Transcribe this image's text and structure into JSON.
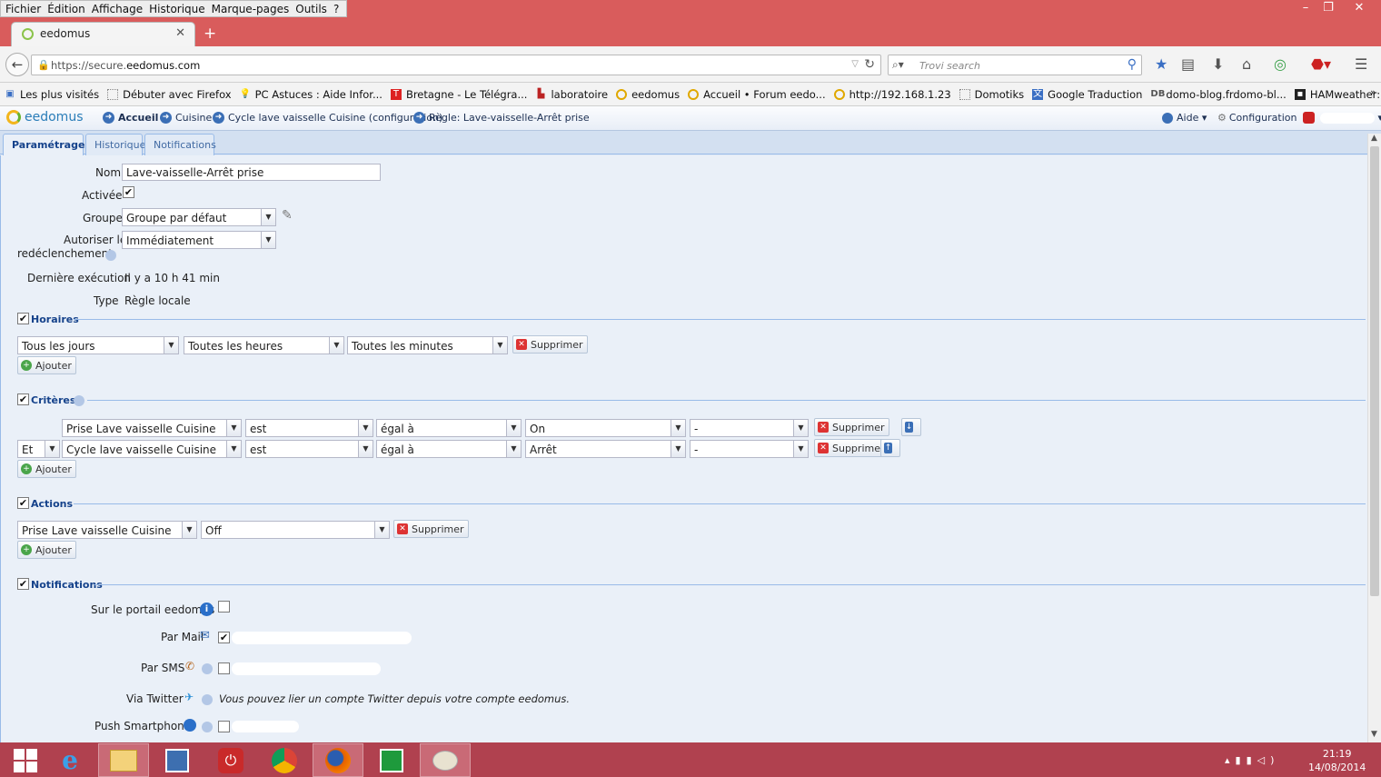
{
  "menu": [
    "Fichier",
    "Édition",
    "Affichage",
    "Historique",
    "Marque-pages",
    "Outils",
    "?"
  ],
  "browser_tab": {
    "title": "eedomus"
  },
  "url": {
    "prefix": "https://secure.",
    "host": "eedomus.com"
  },
  "search": {
    "placeholder": "Trovi search"
  },
  "bookmarks": [
    "Les plus visités",
    "Débuter avec Firefox",
    "PC Astuces : Aide Infor...",
    "Bretagne - Le Télégra...",
    "laboratoire",
    "eedomus",
    "Accueil • Forum eedo...",
    "http://192.168.1.23",
    "Domotiks",
    "Google Traduction",
    "domo-blog.frdomo-bl...",
    "HAMweather: Aeris AP..."
  ],
  "app": {
    "logo": "eedomus",
    "breadcrumb": [
      "Accueil",
      "Cuisine",
      "Cycle lave vaisselle Cuisine (configuration)",
      "Règle: Lave-vaisselle-Arrêt prise"
    ],
    "help": "Aide",
    "config": "Configuration"
  },
  "tabs": [
    "Paramétrage",
    "Historique",
    "Notifications"
  ],
  "form": {
    "nom_label": "Nom",
    "nom_value": "Lave-vaisselle-Arrêt prise",
    "activee_label": "Activée",
    "groupe_label": "Groupe",
    "groupe_value": "Groupe par défaut",
    "redecl_label1": "Autoriser le",
    "redecl_label2": "redéclenchement",
    "redecl_value": "Immédiatement",
    "derniere_label": "Dernière exécution",
    "derniere_value": "Il y a 10 h 41 min",
    "type_label": "Type",
    "type_value": "Règle locale"
  },
  "horaires": {
    "title": "Horaires",
    "jours": "Tous les jours",
    "heures": "Toutes les heures",
    "minutes": "Toutes les minutes",
    "remove": "Supprimer",
    "add": "Ajouter"
  },
  "criteres": {
    "title": "Critères",
    "rows": [
      {
        "op": "",
        "device": "Prise Lave vaisselle Cuisine",
        "verb": "est",
        "cmp": "égal à",
        "value": "On",
        "extra": "-",
        "remove": "Supprimer"
      },
      {
        "op": "Et",
        "device": "Cycle lave vaisselle Cuisine",
        "verb": "est",
        "cmp": "égal à",
        "value": "Arrêt",
        "extra": "-",
        "remove": "Supprimer"
      }
    ],
    "add": "Ajouter"
  },
  "actions": {
    "title": "Actions",
    "device": "Prise Lave vaisselle Cuisine",
    "value": "Off",
    "remove": "Supprimer",
    "add": "Ajouter"
  },
  "notifications": {
    "title": "Notifications",
    "portail": "Sur le portail eedomus",
    "mail": "Par Mail",
    "sms": "Par SMS",
    "twitter": "Via Twitter",
    "twitter_text": "Vous pouvez lier un compte Twitter depuis votre compte eedomus.",
    "push": "Push Smartphone"
  },
  "clock": {
    "time": "21:19",
    "date": "14/08/2014"
  },
  "colors": {
    "accent": "#15428b",
    "titlebar": "#d95c5c",
    "taskbar": "#b0414f"
  }
}
